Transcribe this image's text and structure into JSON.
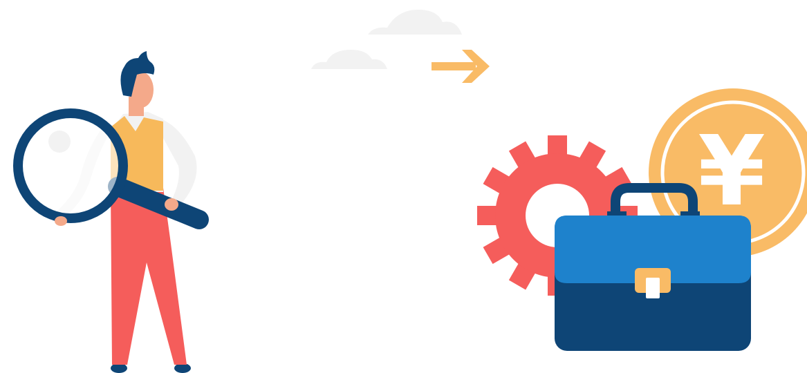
{
  "illustration": {
    "coin": {
      "symbol": "¥",
      "color": "#f9bb66"
    },
    "colors": {
      "navy": "#0e4576",
      "skin": "#f4a98a",
      "vest": "#f7b95b",
      "pants": "#f55d5b",
      "shirt": "#f2f2f2",
      "gear": "#f55d5b",
      "case_top": "#1e82cc",
      "case_bottom": "#0e4576",
      "arrow": "#f9bb66",
      "cloud": "#f2f2f2"
    }
  }
}
